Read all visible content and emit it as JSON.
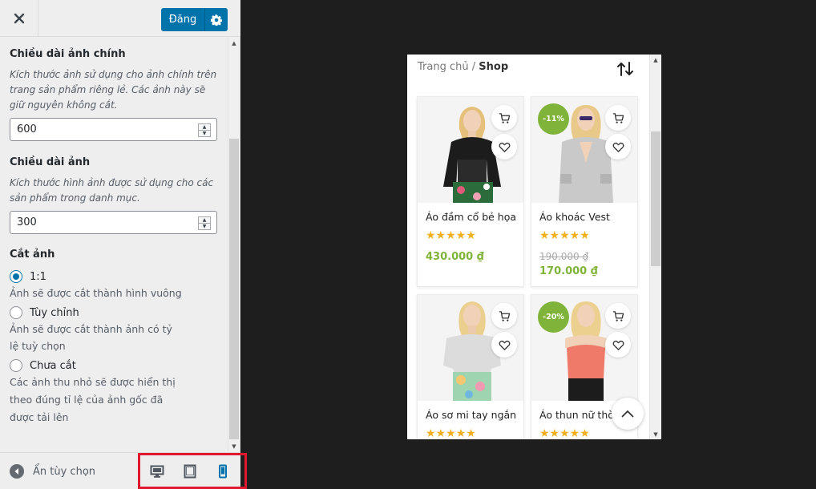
{
  "header": {
    "close_icon": "close-icon",
    "publish_label": "Đăng",
    "settings_icon": "gear-icon"
  },
  "settings": {
    "main_image": {
      "title": "Chiều dài ảnh chính",
      "description": "Kích thước ảnh sử dụng cho ảnh chính trên trang sản phẩm riêng lẻ. Các ảnh này sẽ giữ nguyên không cắt.",
      "value": "600"
    },
    "thumb_image": {
      "title": "Chiều dài ảnh",
      "description": "Kích thước hình ảnh được sử dụng cho các sản phẩm trong danh mục.",
      "value": "300"
    },
    "crop": {
      "title": "Cắt ảnh",
      "options": [
        {
          "label": "1:1",
          "description": "Ảnh sẽ được cắt thành hình vuông",
          "checked": true
        },
        {
          "label": "Tùy chỉnh",
          "description": "Ảnh sẽ được cắt thành ảnh có tỷ lệ tuỳ chọn",
          "checked": false
        },
        {
          "label": "Chưa cắt",
          "description": "Các ảnh thu nhỏ sẽ được hiển thị theo đúng tỉ lệ của ảnh gốc đã được tải lên",
          "checked": false
        }
      ]
    }
  },
  "footer": {
    "collapse_label": "Ẩn tùy chọn",
    "devices": [
      "desktop-icon",
      "tablet-icon",
      "mobile-icon"
    ],
    "active_device": "mobile"
  },
  "preview": {
    "breadcrumb": {
      "home": "Trang chủ",
      "separator": "/",
      "current": "Shop"
    },
    "products": [
      {
        "name": "Áo đầm cổ bẻ họa",
        "stars": "★★★★★",
        "price": "430.000 ₫",
        "old_price": "",
        "badge": ""
      },
      {
        "name": "Áo khoác Vest",
        "stars": "★★★★★",
        "price": "170.000 ₫",
        "old_price": "190.000 ₫",
        "badge": "-11%"
      },
      {
        "name": "Áo sơ mi tay ngắn",
        "stars": "★★★★★",
        "price": "",
        "old_price": "",
        "badge": ""
      },
      {
        "name": "Áo thun nữ thời",
        "stars": "★★★★★",
        "price": "",
        "old_price": "",
        "badge": "-20%"
      }
    ]
  },
  "colors": {
    "primary": "#0073aa",
    "accent_green": "#7fb33a",
    "star": "#f2b01e",
    "highlight": "#e0192f"
  }
}
